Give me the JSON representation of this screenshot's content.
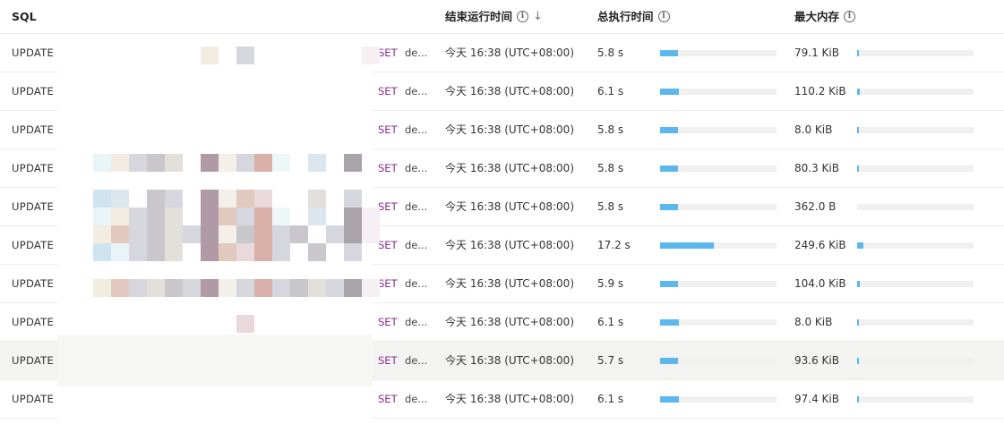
{
  "columns": {
    "sql": "SQL",
    "end_time": "结束运行时间",
    "duration": "总执行时间",
    "memory": "最大内存"
  },
  "icons": {
    "info": "info-circle-icon",
    "sort": "arrow-down-icon"
  },
  "colors": {
    "bar": "#5bb7ee",
    "set_keyword": "#8a2d8f",
    "highlight_row": "#f3f3f2"
  },
  "rows": [
    {
      "keyword": "UPDATE",
      "set": "SET",
      "detail": "de...",
      "end_time": "今天 16:38 (UTC+08:00)",
      "duration": "5.8 s",
      "duration_fraction": 0.15,
      "memory": "79.1 KiB",
      "memory_fraction": 0.015
    },
    {
      "keyword": "UPDATE",
      "set": "SET",
      "detail": "de...",
      "end_time": "今天 16:38 (UTC+08:00)",
      "duration": "6.1 s",
      "duration_fraction": 0.16,
      "memory": "110.2 KiB",
      "memory_fraction": 0.022
    },
    {
      "keyword": "UPDATE",
      "set": "SET",
      "detail": "de...",
      "end_time": "今天 16:38 (UTC+08:00)",
      "duration": "5.8 s",
      "duration_fraction": 0.15,
      "memory": "8.0 KiB",
      "memory_fraction": 0.006
    },
    {
      "keyword": "UPDATE",
      "set": "SET",
      "detail": "de...",
      "end_time": "今天 16:38 (UTC+08:00)",
      "duration": "5.8 s",
      "duration_fraction": 0.15,
      "memory": "80.3 KiB",
      "memory_fraction": 0.015
    },
    {
      "keyword": "UPDATE",
      "set": "SET",
      "detail": "de...",
      "end_time": "今天 16:38 (UTC+08:00)",
      "duration": "5.8 s",
      "duration_fraction": 0.15,
      "memory": "362.0 B",
      "memory_fraction": 0.0
    },
    {
      "keyword": "UPDATE",
      "set": "SET",
      "detail": "de...",
      "end_time": "今天 16:38 (UTC+08:00)",
      "duration": "17.2 s",
      "duration_fraction": 0.46,
      "memory": "249.6 KiB",
      "memory_fraction": 0.05
    },
    {
      "keyword": "UPDATE",
      "set": "SET",
      "detail": "de...",
      "end_time": "今天 16:38 (UTC+08:00)",
      "duration": "5.9 s",
      "duration_fraction": 0.15,
      "memory": "104.0 KiB",
      "memory_fraction": 0.02
    },
    {
      "keyword": "UPDATE",
      "set": "SET",
      "detail": "de...",
      "end_time": "今天 16:38 (UTC+08:00)",
      "duration": "6.1 s",
      "duration_fraction": 0.16,
      "memory": "8.0 KiB",
      "memory_fraction": 0.006
    },
    {
      "keyword": "UPDATE",
      "set": "SET",
      "detail": "de...",
      "end_time": "今天 16:38 (UTC+08:00)",
      "duration": "5.7 s",
      "duration_fraction": 0.15,
      "memory": "93.6 KiB",
      "memory_fraction": 0.018,
      "highlighted": true
    },
    {
      "keyword": "UPDATE",
      "set": "SET",
      "detail": "de...",
      "end_time": "今天 16:38 (UTC+08:00)",
      "duration": "6.1 s",
      "duration_fraction": 0.16,
      "memory": "97.4 KiB",
      "memory_fraction": 0.019
    }
  ]
}
